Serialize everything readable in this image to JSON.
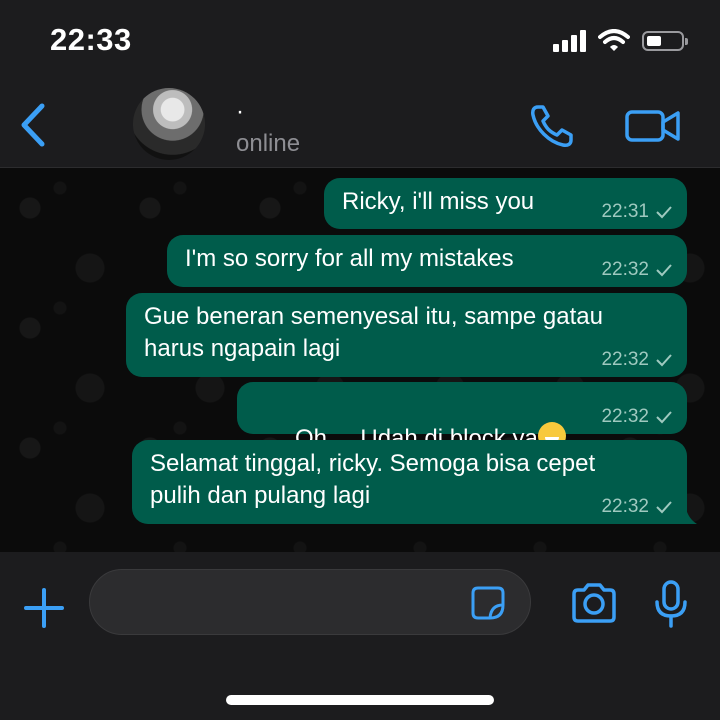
{
  "status_bar": {
    "time": "22:33"
  },
  "header": {
    "contact_name": "·",
    "contact_status": "online"
  },
  "messages": [
    {
      "text": "Ricky, i'll miss you",
      "time": "22:31"
    },
    {
      "text": "I'm so sorry for all my mistakes",
      "time": "22:32"
    },
    {
      "text": "Gue beneran semenyesal itu, sampe gatau\nharus ngapain lagi",
      "time": "22:32"
    },
    {
      "text": "Oh.... Udah di block ya",
      "emoji": "sweat-smile",
      "time": "22:32"
    },
    {
      "text": "Selamat tinggal, ricky. Semoga bisa cepet\npulih dan pulang lagi",
      "time": "22:32"
    }
  ],
  "input": {
    "placeholder": ""
  },
  "colors": {
    "accent": "#3b9ff5",
    "outgoing_bubble": "#005c4b",
    "background": "#1c1c1e"
  }
}
